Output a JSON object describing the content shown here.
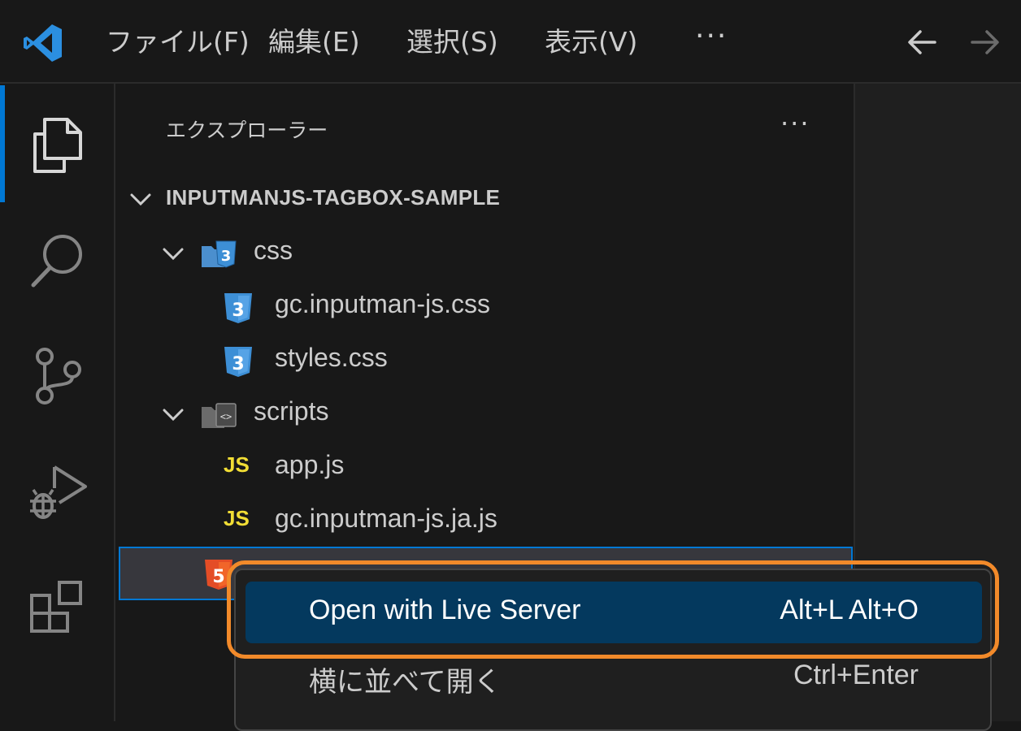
{
  "titlebar": {
    "menus": [
      "ファイル(F)",
      "編集(E)",
      "選択(S)",
      "表示(V)"
    ],
    "more": "···"
  },
  "activitybar": {
    "icons": [
      "explorer-icon",
      "search-icon",
      "source-control-icon",
      "run-debug-icon",
      "extensions-icon"
    ]
  },
  "explorer": {
    "title": "エクスプローラー",
    "more": "···",
    "root": "INPUTMANJS-TAGBOX-SAMPLE",
    "items": [
      {
        "label": "css",
        "type": "folder"
      },
      {
        "label": "gc.inputman-js.css",
        "type": "css"
      },
      {
        "label": "styles.css",
        "type": "css"
      },
      {
        "label": "scripts",
        "type": "folder"
      },
      {
        "label": "app.js",
        "type": "js"
      },
      {
        "label": "gc.inputman-js.ja.js",
        "type": "js"
      },
      {
        "label": "",
        "type": "html"
      }
    ],
    "js_badge": "JS"
  },
  "context_menu": {
    "items": [
      {
        "label": "Open with Live Server",
        "shortcut": "Alt+L Alt+O"
      },
      {
        "label": "横に並べて開く",
        "shortcut": "Ctrl+Enter"
      }
    ]
  },
  "colors": {
    "accent": "#0078d4",
    "callout": "#f28a2a",
    "menu_highlight": "#04395e",
    "js_yellow": "#f1dd35",
    "css_blue": "#3d8fd6",
    "html_orange": "#e44d26"
  }
}
